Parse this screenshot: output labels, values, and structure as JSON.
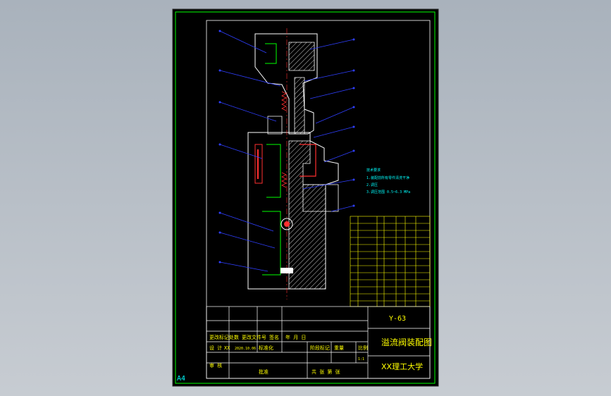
{
  "sheet": {
    "size_label": "A4"
  },
  "title_block": {
    "drawing_no": "Y-63",
    "drawing_name": "溢流阀装配图",
    "school": "XX理工大学",
    "rev_headers": [
      "更改标记处数",
      "更改文件号",
      "签名",
      "年 月 日"
    ],
    "design_label": "设 计",
    "design_name": "XX",
    "design_date": "2020.10.06",
    "standard_label": "标准化",
    "review_label": "审 核",
    "approve_label": "批准",
    "stage_label": "阶段标记",
    "weight_label": "重量",
    "scale_label": "比例",
    "scale_value": "1:1",
    "sheets_label": "共  张  第  张"
  },
  "notes": {
    "lines": [
      "技术要求",
      "1.装配前所有零件清洗干净",
      "2.调压",
      "3.调压范围 0.5~6.3 MPa"
    ]
  },
  "colors": {
    "background": "#000000",
    "frame": "#00ff00",
    "title_text": "#ffff00",
    "leader": "#2f3fff",
    "section": "#ffffff",
    "hatch": "#ff3030",
    "line_cyan": "#00ffff"
  }
}
